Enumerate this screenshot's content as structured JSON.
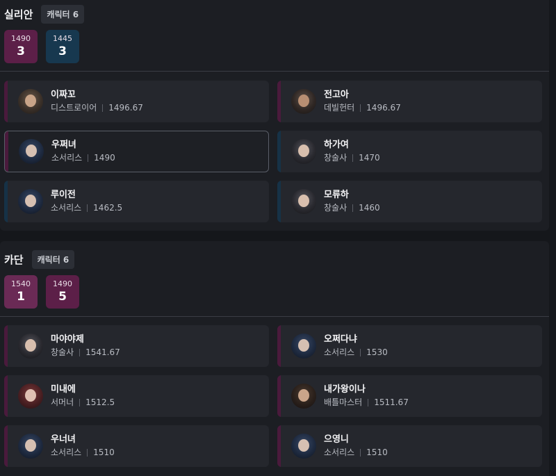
{
  "colors": {
    "purple": "#5c1f48",
    "navy": "#17384f",
    "purple2": "#6a2a55"
  },
  "servers": [
    {
      "name": "실리안",
      "char_count_label": "캐릭터 6",
      "stats": [
        {
          "level": "1490",
          "count": "3",
          "color": "#5c1f48"
        },
        {
          "level": "1445",
          "count": "3",
          "color": "#17384f"
        }
      ],
      "characters": [
        {
          "name": "이짜꼬",
          "class": "디스트로이어",
          "level": "1496.67",
          "bar": "#4a1a3c",
          "selected": false,
          "avatar": "warrior"
        },
        {
          "name": "전고아",
          "class": "데빌헌터",
          "level": "1496.67",
          "bar": "#4a1a3c",
          "selected": false,
          "avatar": "gunner"
        },
        {
          "name": "우쩌녀",
          "class": "소서리스",
          "level": "1490",
          "bar": "#4a1a3c",
          "selected": true,
          "avatar": "mage"
        },
        {
          "name": "하가여",
          "class": "창술사",
          "level": "1470",
          "bar": "#163247",
          "selected": false,
          "avatar": "lancer"
        },
        {
          "name": "루이전",
          "class": "소서리스",
          "level": "1462.5",
          "bar": "#163247",
          "selected": false,
          "avatar": "mage"
        },
        {
          "name": "모류하",
          "class": "창술사",
          "level": "1460",
          "bar": "#163247",
          "selected": false,
          "avatar": "lancer"
        }
      ]
    },
    {
      "name": "카단",
      "char_count_label": "캐릭터 6",
      "stats": [
        {
          "level": "1540",
          "count": "1",
          "color": "#6a2a55"
        },
        {
          "level": "1490",
          "count": "5",
          "color": "#5c1f48"
        }
      ],
      "characters": [
        {
          "name": "마야야제",
          "class": "창술사",
          "level": "1541.67",
          "bar": "#4a1a3c",
          "selected": false,
          "avatar": "lancer"
        },
        {
          "name": "오쩌다냐",
          "class": "소서리스",
          "level": "1530",
          "bar": "#4a1a3c",
          "selected": false,
          "avatar": "mage"
        },
        {
          "name": "미내에",
          "class": "서머너",
          "level": "1512.5",
          "bar": "#4a1a3c",
          "selected": false,
          "avatar": "summoner"
        },
        {
          "name": "내가왕이나",
          "class": "배틀마스터",
          "level": "1511.67",
          "bar": "#4a1a3c",
          "selected": false,
          "avatar": "fighter"
        },
        {
          "name": "우너녀",
          "class": "소서리스",
          "level": "1510",
          "bar": "#4a1a3c",
          "selected": false,
          "avatar": "mage"
        },
        {
          "name": "으영니",
          "class": "소서리스",
          "level": "1510",
          "bar": "#4a1a3c",
          "selected": false,
          "avatar": "mage"
        }
      ]
    }
  ]
}
